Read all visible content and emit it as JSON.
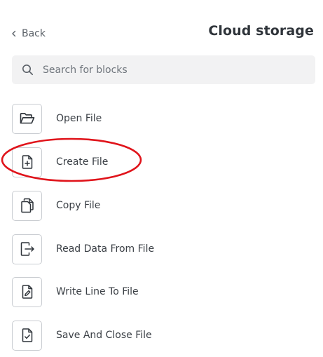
{
  "header": {
    "back_label": "Back",
    "title": "Cloud storage"
  },
  "search": {
    "placeholder": "Search for blocks",
    "value": ""
  },
  "blocks": [
    {
      "label": "Open File",
      "icon": "folder-open-icon"
    },
    {
      "label": "Create File",
      "icon": "file-plus-icon"
    },
    {
      "label": "Copy File",
      "icon": "copy-file-icon"
    },
    {
      "label": "Read Data From File",
      "icon": "file-export-icon"
    },
    {
      "label": "Write Line To File",
      "icon": "file-edit-icon"
    },
    {
      "label": "Save And Close File",
      "icon": "file-check-icon"
    }
  ],
  "annotation": {
    "highlighted_block": "Create File",
    "color": "#e0141b"
  },
  "colors": {
    "icon_stroke": "#2f343a",
    "tile_border": "#c9ccd1",
    "search_bg": "#f2f2f3"
  }
}
